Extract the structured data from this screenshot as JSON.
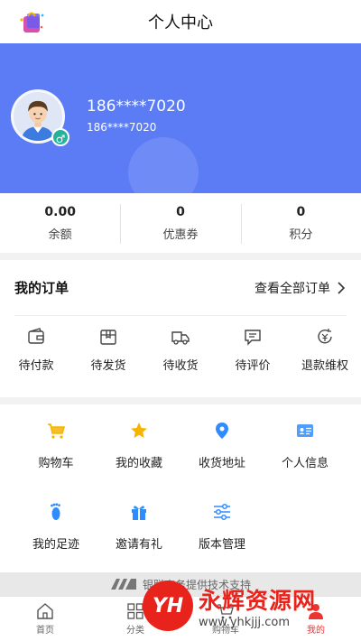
{
  "header": {
    "title": "个人中心"
  },
  "profile": {
    "name": "186****7020",
    "sub": "186****7020",
    "gender_symbol": "♂"
  },
  "stats": [
    {
      "value": "0.00",
      "label": "余额"
    },
    {
      "value": "0",
      "label": "优惠券"
    },
    {
      "value": "0",
      "label": "积分"
    }
  ],
  "orders": {
    "title": "我的订单",
    "view_all": "查看全部订单",
    "items": [
      {
        "label": "待付款",
        "icon": "wallet-icon"
      },
      {
        "label": "待发货",
        "icon": "box-icon"
      },
      {
        "label": "待收货",
        "icon": "truck-icon"
      },
      {
        "label": "待评价",
        "icon": "comment-icon"
      },
      {
        "label": "退款维权",
        "icon": "refund-icon"
      }
    ]
  },
  "services": [
    {
      "label": "购物车",
      "icon": "cart-icon"
    },
    {
      "label": "我的收藏",
      "icon": "star-icon"
    },
    {
      "label": "收货地址",
      "icon": "location-icon"
    },
    {
      "label": "个人信息",
      "icon": "id-card-icon"
    },
    {
      "label": "我的足迹",
      "icon": "footprint-icon"
    },
    {
      "label": "邀请有礼",
      "icon": "gift-icon"
    },
    {
      "label": "版本管理",
      "icon": "sliders-icon"
    }
  ],
  "footer_credit": "银联商务提供技术支持",
  "tabbar": [
    {
      "label": "首页",
      "icon": "home-icon"
    },
    {
      "label": "分类",
      "icon": "grid-icon"
    },
    {
      "label": "购物车",
      "icon": "cart-icon"
    },
    {
      "label": "我的",
      "icon": "user-icon"
    }
  ],
  "watermark": {
    "logo": "YH",
    "name": "永辉资源网",
    "url": "www.yhkjjj.com"
  },
  "colors": {
    "banner": "#5b7cf5",
    "accent": "#e33333",
    "gender": "#26b19b",
    "icon_gold": "#f5b400",
    "icon_blue": "#2f8cff"
  }
}
